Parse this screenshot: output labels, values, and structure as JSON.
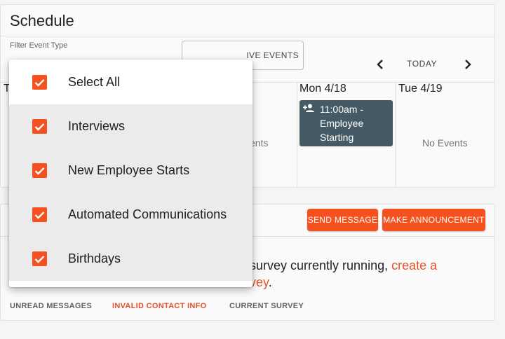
{
  "schedule": {
    "title": "Schedule",
    "filter_label": "Filter Event Type",
    "events_button_label": "IVE EVENTS",
    "today_label": "TODAY",
    "days": [
      {
        "label": "T",
        "events": []
      },
      {
        "label": "",
        "no_events": "ents"
      },
      {
        "label": "Mon 4/18",
        "event": {
          "icon": "person-add-icon",
          "lines": [
            "11:00am -",
            "Employee",
            "Starting"
          ]
        }
      },
      {
        "label": "Tue 4/19",
        "no_events": "No Events"
      }
    ]
  },
  "filter_dropdown": {
    "options": [
      {
        "label": "Select All",
        "checked": true
      },
      {
        "label": "Interviews",
        "checked": true
      },
      {
        "label": "New Employee Starts",
        "checked": true
      },
      {
        "label": "Automated Communications",
        "checked": true
      },
      {
        "label": "Birthdays",
        "checked": true
      }
    ]
  },
  "messages": {
    "send_message_label": "SEND MESSAGE",
    "make_announcement_label": "MAKE ANNOUNCEMENT",
    "survey_text": "survey currently running,",
    "survey_link_text_1": "create a",
    "survey_link_text_2": "vey",
    "survey_period": ".",
    "tabs": [
      {
        "label": "UNREAD MESSAGES"
      },
      {
        "label": "INVALID CONTACT INFO"
      },
      {
        "label": "CURRENT SURVEY"
      }
    ]
  },
  "colors": {
    "accent": "#f4511e",
    "event_chip": "#455a64",
    "link": "#e8532a"
  }
}
